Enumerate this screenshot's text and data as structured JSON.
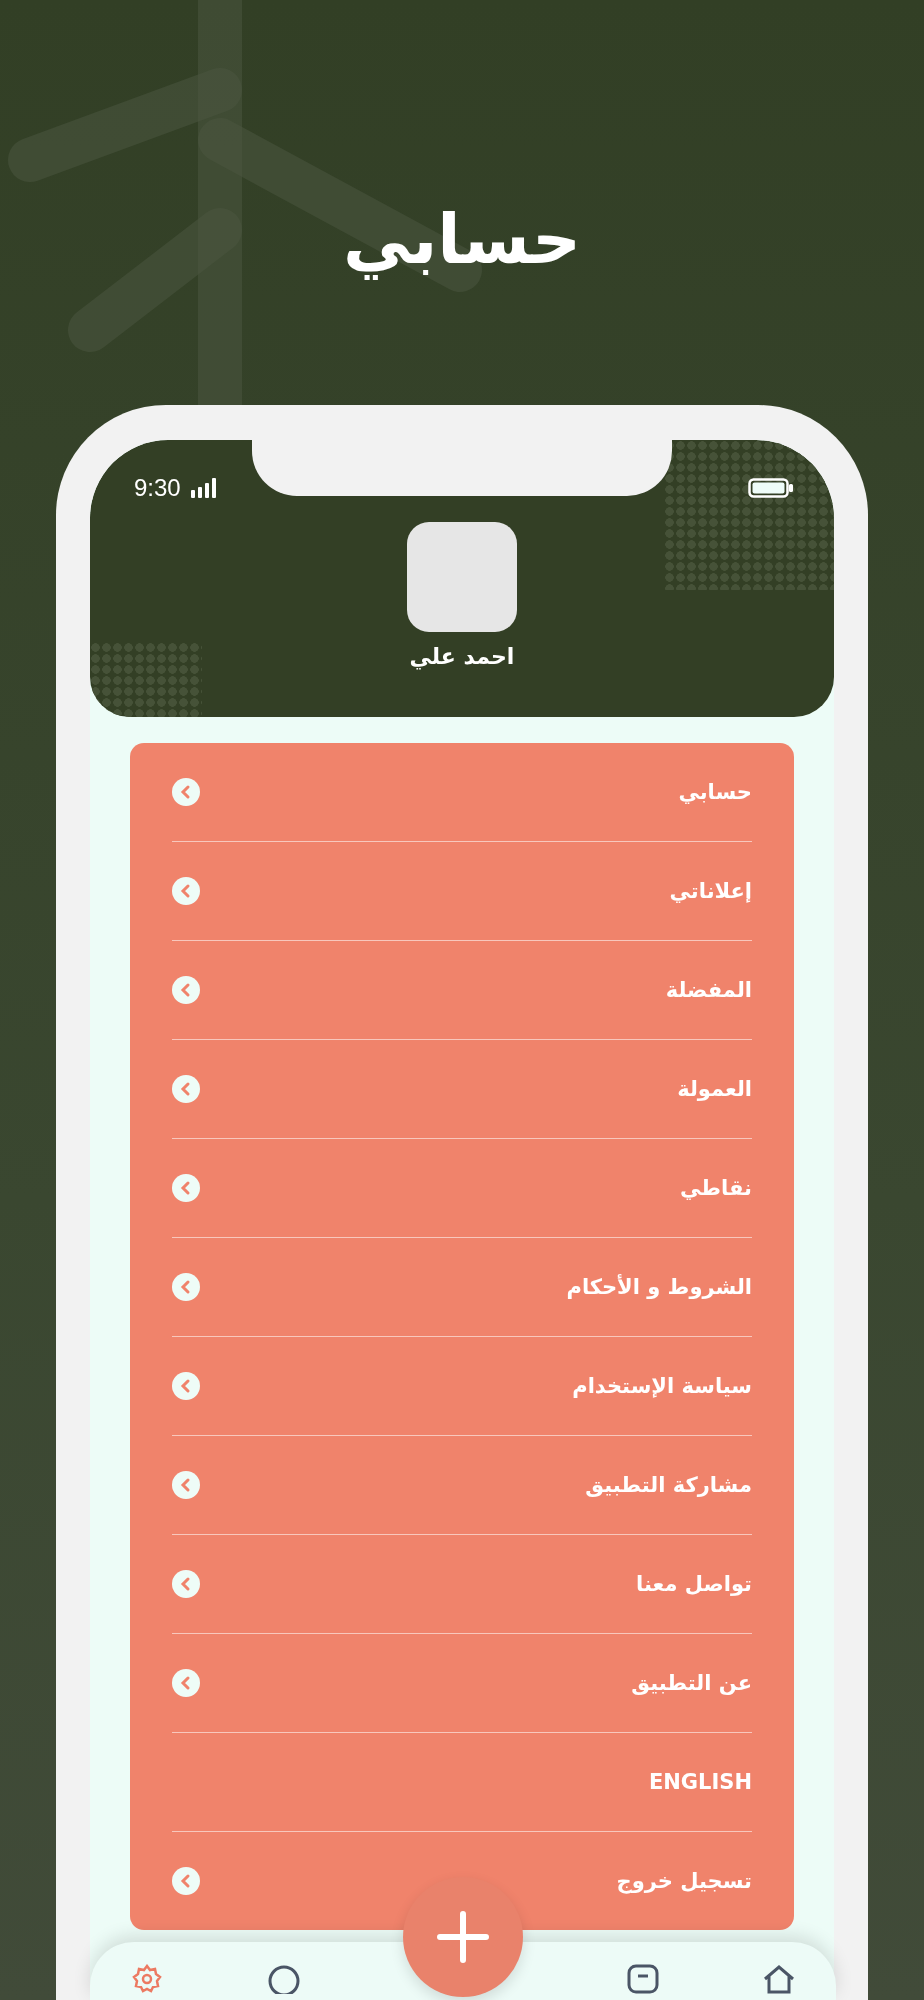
{
  "page_title": "حسابي",
  "status_bar": {
    "time": "9:30"
  },
  "profile": {
    "name": "احمد علي"
  },
  "menu": [
    {
      "label": "حسابي",
      "kind": "link"
    },
    {
      "label": "إعلاناتي",
      "kind": "link"
    },
    {
      "label": "المفضلة",
      "kind": "link"
    },
    {
      "label": "العمولة",
      "kind": "link"
    },
    {
      "label": "نقاطي",
      "kind": "link"
    },
    {
      "label": "الشروط و الأحكام",
      "kind": "link"
    },
    {
      "label": "سياسة الإستخدام",
      "kind": "link"
    },
    {
      "label": "مشاركة التطبيق",
      "kind": "link"
    },
    {
      "label": "تواصل معنا",
      "kind": "link"
    },
    {
      "label": "عن التطبيق",
      "kind": "link"
    },
    {
      "label": "ENGLISH",
      "kind": "language"
    },
    {
      "label": "تسجيل خروج",
      "kind": "link"
    }
  ],
  "nav_bar": {
    "items": [
      {
        "kind": "home",
        "selected": false
      },
      {
        "kind": "messages",
        "selected": false
      },
      {
        "kind": "chat",
        "selected": false
      },
      {
        "kind": "settings",
        "selected": true
      }
    ]
  }
}
